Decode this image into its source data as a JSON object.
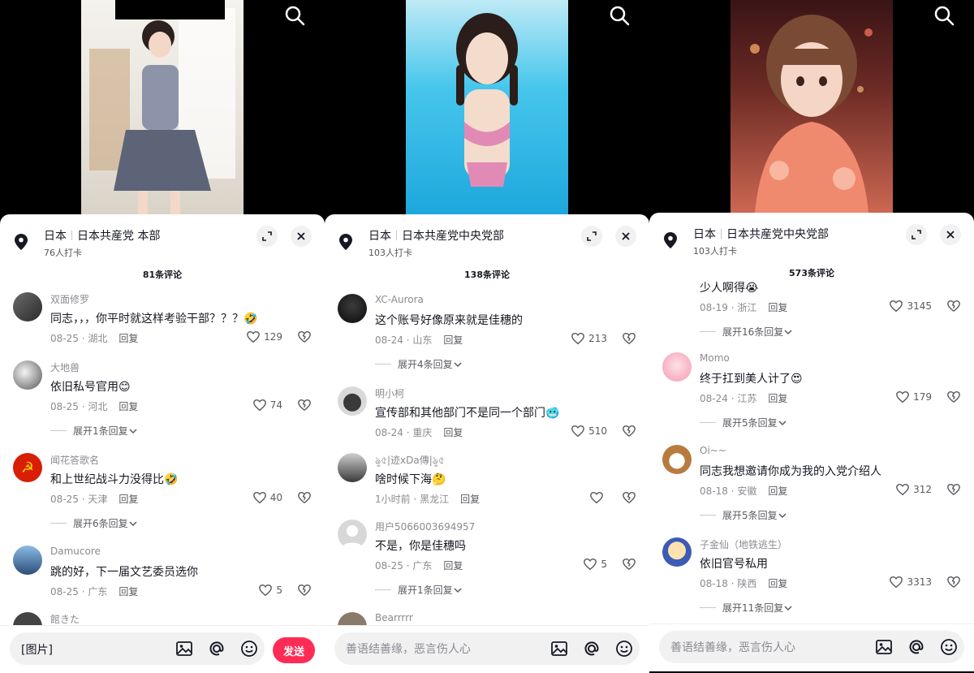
{
  "colors": {
    "accent": "#fe2c55",
    "muted": "#8a8b91",
    "text": "#161823"
  },
  "panels": [
    {
      "location": {
        "country": "日本",
        "place": "日本共産党 本部",
        "checkins": "76人打卡"
      },
      "comment_count": "81条评论",
      "comments": [
        {
          "user": "双面修罗",
          "text": "同志，，，你平时就这样考验干部？？？🤣",
          "date": "08-25",
          "region": "湖北",
          "reply": "回复",
          "likes": "129"
        },
        {
          "user": "大地兽",
          "text": "依旧私号官用😊",
          "date": "08-25",
          "region": "河北",
          "reply": "回复",
          "likes": "74",
          "expand": "展开1条回复"
        },
        {
          "user": "闻花答歌名",
          "text": "和上世纪战斗力没得比🤣",
          "date": "08-25",
          "region": "天津",
          "reply": "回复",
          "likes": "40",
          "expand": "展开6条回复"
        },
        {
          "user": "Damucore",
          "text": "跳的好，下一届文艺委员选你",
          "date": "08-25",
          "region": "广东",
          "reply": "回复",
          "likes": "5"
        },
        {
          "user": "館きた"
        }
      ],
      "input": {
        "value": "[图片]",
        "send_label": "发送"
      }
    },
    {
      "location": {
        "country": "日本",
        "place": "日本共産党中央党部",
        "checkins": "103人打卡"
      },
      "comment_count": "138条评论",
      "comments": [
        {
          "user": "XC-Aurora",
          "text": "这个账号好像原来就是佳穗的",
          "date": "08-24",
          "region": "山东",
          "reply": "回复",
          "likes": "213",
          "expand": "展开4条回复"
        },
        {
          "user": "明小柯",
          "text": "宣传部和其他部门不是同一个部门🥶",
          "date": "08-24",
          "region": "重庆",
          "reply": "回复",
          "likes": "510"
        },
        {
          "user": "ৡ৫|迹xDa傳|ৡ৫",
          "text": "啥时候下海🤔",
          "date": "1小时前",
          "region": "黑龙江",
          "reply": "回复",
          "likes": ""
        },
        {
          "user": "用户5066003694957",
          "text": "不是，你是佳穗吗",
          "date": "08-25",
          "region": "广东",
          "reply": "回复",
          "likes": "5",
          "expand": "展开1条回复"
        },
        {
          "user": "Bearrrrr"
        }
      ],
      "input": {
        "placeholder": "善语结善缘，恶言伤人心"
      }
    },
    {
      "location": {
        "country": "日本",
        "place": "日本共産党中央党部",
        "checkins": "103人打卡"
      },
      "comment_count": "573条评论",
      "comments": [
        {
          "user": "",
          "text": "少人啊得😭",
          "date": "08-19",
          "region": "浙江",
          "reply": "回复",
          "likes": "3145",
          "expand": "展开16条回复"
        },
        {
          "user": "Momo",
          "text": "终于扛到美人计了😍",
          "date": "08-24",
          "region": "江苏",
          "reply": "回复",
          "likes": "179",
          "expand": "展开5条回复"
        },
        {
          "user": "Oi~~",
          "text": "同志我想邀请你成为我的入党介绍人",
          "date": "08-18",
          "region": "安徽",
          "reply": "回复",
          "likes": "312",
          "expand": "展开5条回复"
        },
        {
          "user": "子金仙（地铁逃生）",
          "text": "依旧官号私用",
          "date": "08-18",
          "region": "陕西",
          "reply": "回复",
          "likes": "3313",
          "expand": "展开11条回复"
        }
      ],
      "input": {
        "placeholder": "善语结善缘，恶言伤人心"
      }
    }
  ]
}
